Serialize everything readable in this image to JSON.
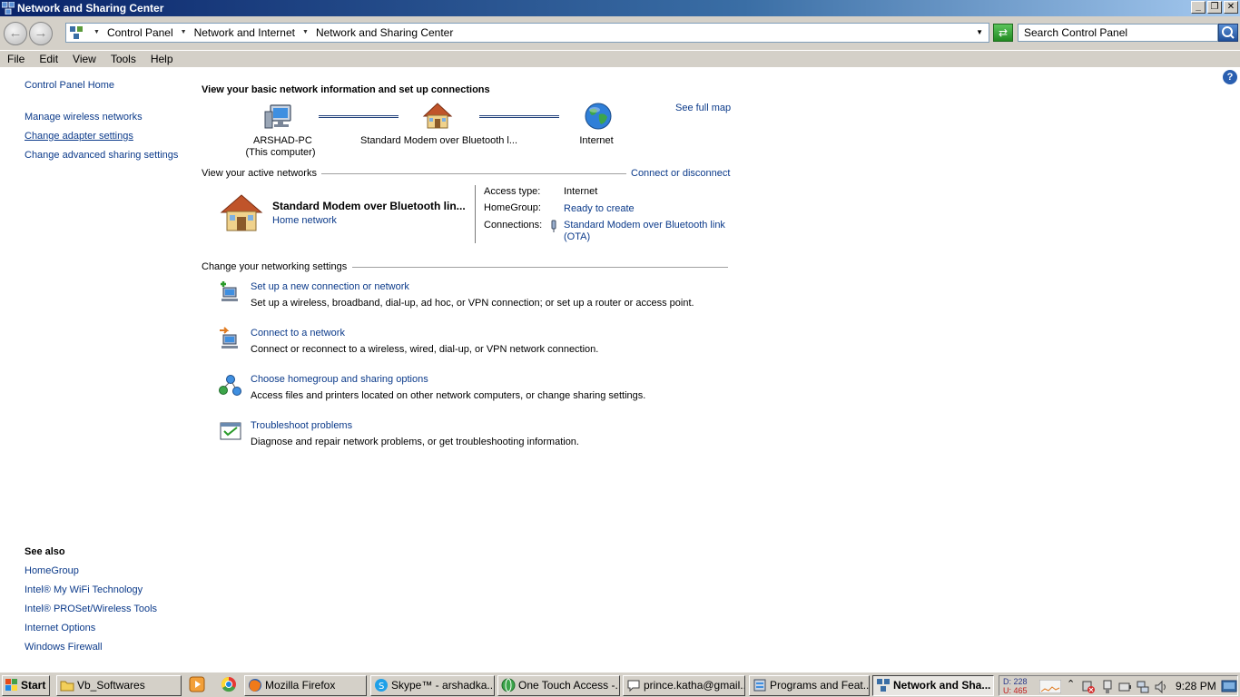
{
  "window": {
    "title": "Network and Sharing Center"
  },
  "window_buttons": {
    "minimize": "_",
    "restore": "❐",
    "close": "✕"
  },
  "address": {
    "crumbs": [
      "Control Panel",
      "Network and Internet",
      "Network and Sharing Center"
    ],
    "search_placeholder": "Search Control Panel"
  },
  "menu": [
    "File",
    "Edit",
    "View",
    "Tools",
    "Help"
  ],
  "sidebar": {
    "links": [
      "Control Panel Home",
      "Manage wireless networks",
      "Change adapter settings",
      "Change advanced sharing settings"
    ],
    "see_also_title": "See also",
    "see_also": [
      "HomeGroup",
      "Intel® My WiFi Technology",
      "Intel® PROSet/Wireless Tools",
      "Internet Options",
      "Windows Firewall"
    ]
  },
  "main": {
    "heading": "View your basic network information and set up connections",
    "see_full_map": "See full map",
    "map": {
      "computer_name": "ARSHAD-PC",
      "computer_sub": "(This computer)",
      "middle": "Standard Modem over Bluetooth l...",
      "internet": "Internet"
    },
    "active_title": "View your active networks",
    "connect_disconnect": "Connect or disconnect",
    "network": {
      "name": "Standard Modem over Bluetooth lin...",
      "type": "Home network",
      "access_type_label": "Access type:",
      "access_type_value": "Internet",
      "homegroup_label": "HomeGroup:",
      "homegroup_value": "Ready to create",
      "connections_label": "Connections:",
      "connections_value_1": "Standard Modem over Bluetooth link",
      "connections_value_2": "(OTA)"
    },
    "settings_title": "Change your networking settings",
    "tasks": [
      {
        "title": "Set up a new connection or network",
        "desc": "Set up a wireless, broadband, dial-up, ad hoc, or VPN connection; or set up a router or access point."
      },
      {
        "title": "Connect to a network",
        "desc": "Connect or reconnect to a wireless, wired, dial-up, or VPN network connection."
      },
      {
        "title": "Choose homegroup and sharing options",
        "desc": "Access files and printers located on other network computers, or change sharing settings."
      },
      {
        "title": "Troubleshoot problems",
        "desc": "Diagnose and repair network problems, or get troubleshooting information."
      }
    ]
  },
  "taskbar": {
    "start": "Start",
    "buttons": [
      "Vb_Softwares",
      "Mozilla Firefox",
      "Skype™ - arshadka...",
      "One Touch Access -...",
      "prince.katha@gmail....",
      "Programs and Feat...",
      "Network and Sha..."
    ],
    "net_d": "D: 228",
    "net_u": "U: 465",
    "clock": "9:28 PM"
  }
}
